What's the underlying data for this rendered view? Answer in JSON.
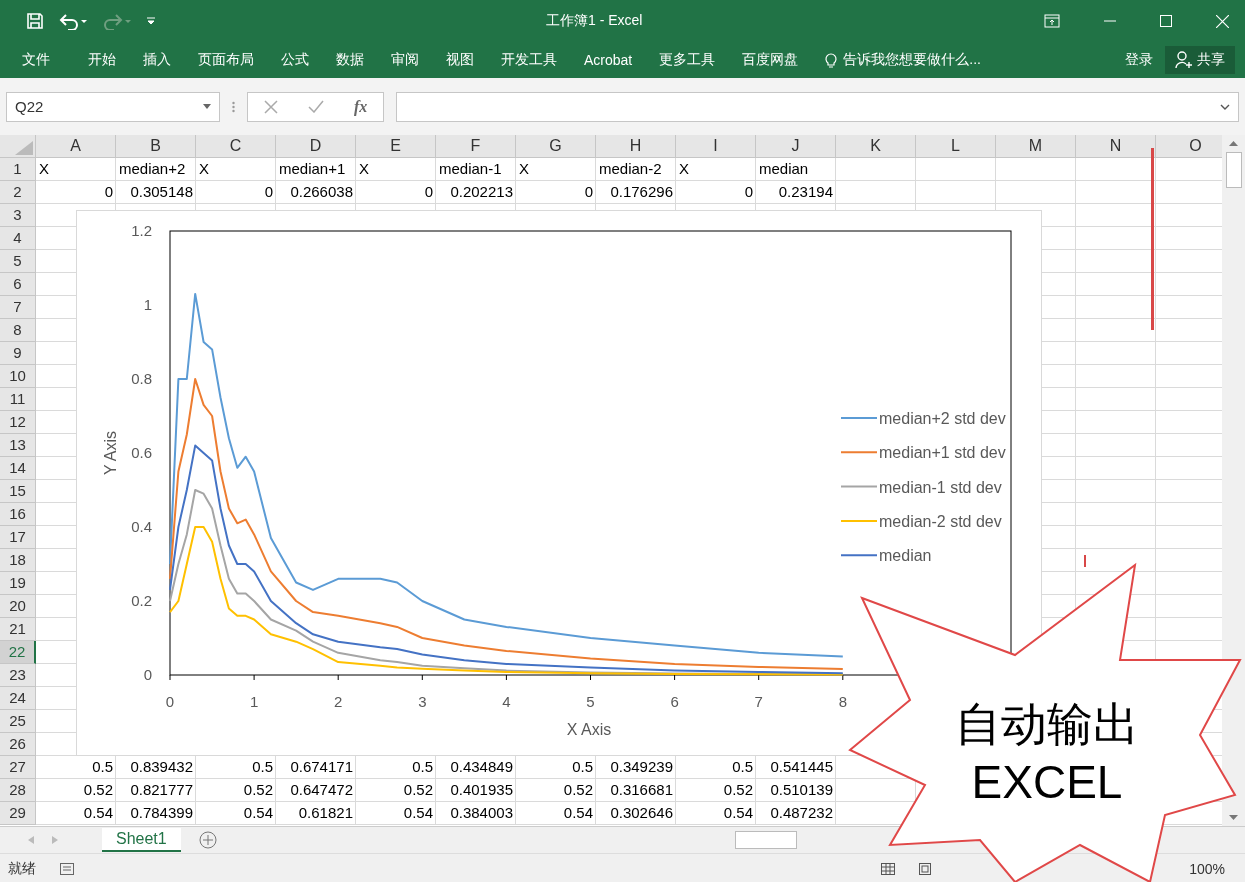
{
  "window": {
    "title": "工作簿1 - Excel"
  },
  "ribbon": {
    "tabs": [
      {
        "label": "文件"
      },
      {
        "label": "开始"
      },
      {
        "label": "插入"
      },
      {
        "label": "页面布局"
      },
      {
        "label": "公式"
      },
      {
        "label": "数据"
      },
      {
        "label": "审阅"
      },
      {
        "label": "视图"
      },
      {
        "label": "开发工具"
      },
      {
        "label": "Acrobat"
      },
      {
        "label": "更多工具"
      },
      {
        "label": "百度网盘"
      }
    ],
    "tell_me": "告诉我您想要做什么...",
    "sign_in": "登录",
    "share": "共享"
  },
  "formula_bar": {
    "name_box": "Q22",
    "function_label": "fx"
  },
  "columns": [
    "A",
    "B",
    "C",
    "D",
    "E",
    "F",
    "G",
    "H",
    "I",
    "J",
    "K",
    "L",
    "M",
    "N",
    "O"
  ],
  "rows": [
    {
      "number": "1",
      "selected": false,
      "cells": [
        {
          "text": "X",
          "kind": "text"
        },
        {
          "text": "median+2",
          "kind": "text"
        },
        {
          "text": "X",
          "kind": "text"
        },
        {
          "text": "median+1",
          "kind": "text"
        },
        {
          "text": "X",
          "kind": "text"
        },
        {
          "text": "median-1",
          "kind": "text"
        },
        {
          "text": "X",
          "kind": "text"
        },
        {
          "text": "median-2",
          "kind": "text"
        },
        {
          "text": "X",
          "kind": "text"
        },
        {
          "text": "median",
          "kind": "text"
        }
      ]
    },
    {
      "number": "2",
      "selected": false,
      "cells": [
        {
          "text": "0",
          "kind": "number"
        },
        {
          "text": "0.305148",
          "kind": "number"
        },
        {
          "text": "0",
          "kind": "number"
        },
        {
          "text": "0.266038",
          "kind": "number"
        },
        {
          "text": "0",
          "kind": "number"
        },
        {
          "text": "0.202213",
          "kind": "number"
        },
        {
          "text": "0",
          "kind": "number"
        },
        {
          "text": "0.176296",
          "kind": "number"
        },
        {
          "text": "0",
          "kind": "number"
        },
        {
          "text": "0.23194",
          "kind": "number"
        }
      ]
    },
    {
      "number": "3",
      "selected": false
    },
    {
      "number": "4",
      "selected": false
    },
    {
      "number": "5",
      "selected": false
    },
    {
      "number": "6",
      "selected": false
    },
    {
      "number": "7",
      "selected": false
    },
    {
      "number": "8",
      "selected": false
    },
    {
      "number": "9",
      "selected": false
    },
    {
      "number": "10",
      "selected": false
    },
    {
      "number": "11",
      "selected": false
    },
    {
      "number": "12",
      "selected": false
    },
    {
      "number": "13",
      "selected": false
    },
    {
      "number": "14",
      "selected": false
    },
    {
      "number": "15",
      "selected": false
    },
    {
      "number": "16",
      "selected": false
    },
    {
      "number": "17",
      "selected": false
    },
    {
      "number": "18",
      "selected": false
    },
    {
      "number": "19",
      "selected": false
    },
    {
      "number": "20",
      "selected": false
    },
    {
      "number": "21",
      "selected": false
    },
    {
      "number": "22",
      "selected": true
    },
    {
      "number": "23",
      "selected": false
    },
    {
      "number": "24",
      "selected": false
    },
    {
      "number": "25",
      "selected": false
    },
    {
      "number": "26",
      "selected": false
    },
    {
      "number": "27",
      "selected": false,
      "cells": [
        {
          "text": "0.5",
          "kind": "number"
        },
        {
          "text": "0.839432",
          "kind": "number"
        },
        {
          "text": "0.5",
          "kind": "number"
        },
        {
          "text": "0.674171",
          "kind": "number"
        },
        {
          "text": "0.5",
          "kind": "number"
        },
        {
          "text": "0.434849",
          "kind": "number"
        },
        {
          "text": "0.5",
          "kind": "number"
        },
        {
          "text": "0.349239",
          "kind": "number"
        },
        {
          "text": "0.5",
          "kind": "number"
        },
        {
          "text": "0.541445",
          "kind": "number"
        }
      ]
    },
    {
      "number": "28",
      "selected": false,
      "cells": [
        {
          "text": "0.52",
          "kind": "number"
        },
        {
          "text": "0.821777",
          "kind": "number"
        },
        {
          "text": "0.52",
          "kind": "number"
        },
        {
          "text": "0.647472",
          "kind": "number"
        },
        {
          "text": "0.52",
          "kind": "number"
        },
        {
          "text": "0.401935",
          "kind": "number"
        },
        {
          "text": "0.52",
          "kind": "number"
        },
        {
          "text": "0.316681",
          "kind": "number"
        },
        {
          "text": "0.52",
          "kind": "number"
        },
        {
          "text": "0.510139",
          "kind": "number"
        }
      ]
    },
    {
      "number": "29",
      "selected": false,
      "cells": [
        {
          "text": "0.54",
          "kind": "number"
        },
        {
          "text": "0.784399",
          "kind": "number"
        },
        {
          "text": "0.54",
          "kind": "number"
        },
        {
          "text": "0.61821",
          "kind": "number"
        },
        {
          "text": "0.54",
          "kind": "number"
        },
        {
          "text": "0.384003",
          "kind": "number"
        },
        {
          "text": "0.54",
          "kind": "number"
        },
        {
          "text": "0.302646",
          "kind": "number"
        },
        {
          "text": "0.54",
          "kind": "number"
        },
        {
          "text": "0.487232",
          "kind": "number"
        }
      ]
    }
  ],
  "chart": {
    "chart_data": {
      "type": "line",
      "legend": "right",
      "xlabel": "X Axis",
      "ylabel": "Y Axis",
      "xlim": [
        0,
        10
      ],
      "ylim": [
        0,
        1.2
      ],
      "xticks": [
        0,
        1,
        2,
        3,
        4,
        5,
        6,
        7,
        8
      ],
      "yticks": [
        0,
        0.2,
        0.4,
        0.6,
        0.8,
        1,
        1.2
      ],
      "x": [
        0,
        0.1,
        0.2,
        0.3,
        0.4,
        0.5,
        0.6,
        0.7,
        0.8,
        0.9,
        1,
        1.2,
        1.5,
        1.7,
        2,
        2.5,
        2.7,
        3,
        3.5,
        4,
        5,
        6,
        7,
        8
      ],
      "series": [
        {
          "name": "median+2 std dev",
          "color": "#5b9bd5",
          "values": [
            0.3,
            0.8,
            0.8,
            1.03,
            0.9,
            0.88,
            0.75,
            0.64,
            0.56,
            0.59,
            0.55,
            0.37,
            0.25,
            0.23,
            0.26,
            0.26,
            0.25,
            0.2,
            0.15,
            0.13,
            0.1,
            0.08,
            0.06,
            0.05
          ]
        },
        {
          "name": "median+1 std dev",
          "color": "#ed7d31",
          "values": [
            0.26,
            0.55,
            0.65,
            0.8,
            0.73,
            0.7,
            0.55,
            0.45,
            0.41,
            0.42,
            0.38,
            0.28,
            0.2,
            0.17,
            0.16,
            0.14,
            0.13,
            0.1,
            0.08,
            0.065,
            0.045,
            0.03,
            0.022,
            0.016
          ]
        },
        {
          "name": "median-1 std dev",
          "color": "#a5a5a5",
          "values": [
            0.2,
            0.3,
            0.38,
            0.5,
            0.49,
            0.45,
            0.35,
            0.26,
            0.22,
            0.22,
            0.2,
            0.15,
            0.12,
            0.09,
            0.06,
            0.04,
            0.035,
            0.025,
            0.018,
            0.012,
            0.007,
            0.004,
            0.003,
            0.002
          ]
        },
        {
          "name": "median-2 std dev",
          "color": "#ffc000",
          "values": [
            0.17,
            0.2,
            0.3,
            0.4,
            0.4,
            0.36,
            0.26,
            0.18,
            0.16,
            0.16,
            0.15,
            0.11,
            0.09,
            0.07,
            0.035,
            0.025,
            0.02,
            0.017,
            0.012,
            0.008,
            0.005,
            0.003,
            0.002,
            0.001
          ]
        },
        {
          "name": "median",
          "color": "#4472c4",
          "values": [
            0.23,
            0.4,
            0.5,
            0.62,
            0.6,
            0.58,
            0.45,
            0.35,
            0.3,
            0.3,
            0.28,
            0.2,
            0.14,
            0.11,
            0.09,
            0.075,
            0.07,
            0.055,
            0.04,
            0.03,
            0.02,
            0.012,
            0.008,
            0.005
          ]
        }
      ]
    }
  },
  "callout": {
    "lines": [
      "自动输出",
      "EXCEL"
    ]
  },
  "sheet_tabs": [
    {
      "label": "Sheet1",
      "selected": true
    }
  ],
  "status_bar": {
    "status": "就绪",
    "zoom": "100%"
  }
}
